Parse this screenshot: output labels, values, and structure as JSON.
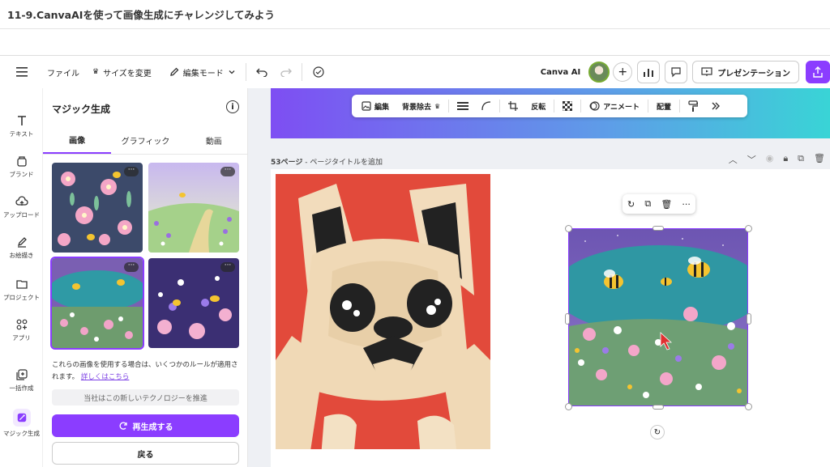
{
  "page_header": {
    "title": "11-9.CanvaAIを使って画像生成にチャレンジしてみよう"
  },
  "toolbar": {
    "menu_icon": "hamburger-icon",
    "file_label": "ファイル",
    "resize_label": "サイズを変更",
    "edit_mode_label": "編集モード",
    "canva_ai_label": "Canva AI",
    "presentation_label": "プレゼンテーション"
  },
  "rail": {
    "items": [
      {
        "label": "テキスト",
        "icon": "text-icon"
      },
      {
        "label": "ブランド",
        "icon": "brand-icon"
      },
      {
        "label": "アップロード",
        "icon": "upload-icon"
      },
      {
        "label": "お絵描き",
        "icon": "draw-icon"
      },
      {
        "label": "プロジェクト",
        "icon": "folder-icon"
      },
      {
        "label": "アプリ",
        "icon": "apps-icon"
      },
      {
        "label": "一括作成",
        "icon": "bulk-create-icon"
      },
      {
        "label": "マジック生成",
        "icon": "magic-icon"
      }
    ]
  },
  "panel": {
    "title": "マジック生成",
    "tabs": [
      "画像",
      "グラフィック",
      "動画"
    ],
    "active_tab": 0,
    "note_text": "これらの画像を使用する場合は、いくつかのルールが適用されます。",
    "note_link": "詳しくはこちら",
    "grey_text": "当社はこの新しいテクノロジーを推進",
    "regenerate_label": "再生成する",
    "back_label": "戻る"
  },
  "context_bar": {
    "edit_label": "編集",
    "bg_remove_label": "背景除去",
    "flip_label": "反転",
    "animate_label": "アニメート",
    "arrange_label": "配置"
  },
  "page_info": {
    "page_number": "53ページ",
    "add_title": "ページタイトルを追加"
  },
  "colors": {
    "accent": "#8b3dff",
    "dog_bg": "#e24a3b",
    "banner_start": "#7e4ef3",
    "banner_end": "#39d4d6"
  }
}
